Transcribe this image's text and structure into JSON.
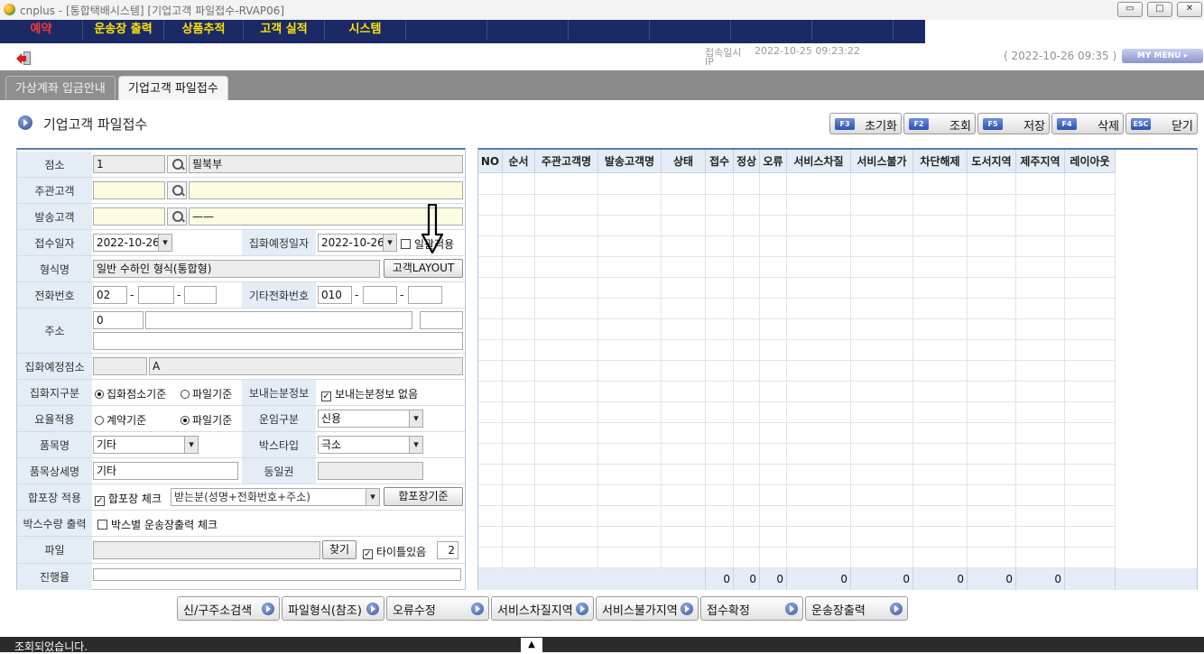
{
  "window": {
    "title": "cnplus - [통합택배시스템] [기업고객 파일접수-RVAP06]",
    "min_glyph": "▭",
    "max_glyph": "□",
    "close_glyph": "✕"
  },
  "menu": [
    "예약",
    "운송장 출력",
    "상품추적",
    "고객 실적",
    "시스템"
  ],
  "info": {
    "login_label": "접속일시",
    "login_value": "2022-10-25 09:23:22",
    "ip_label": "IP",
    "current_time": "( 2022-10-26 09:35 )",
    "my_menu": "MY MENU  ▸"
  },
  "tabs": [
    {
      "label": "가상계좌 입금안내",
      "active": false
    },
    {
      "label": "기업고객 파일접수",
      "active": true
    }
  ],
  "page": {
    "title": "기업고객 파일접수"
  },
  "function_buttons": [
    {
      "key": "F3",
      "label": "초기화"
    },
    {
      "key": "F2",
      "label": "조회"
    },
    {
      "key": "F5",
      "label": "저장"
    },
    {
      "key": "F4",
      "label": "삭제"
    },
    {
      "key": "ESC",
      "label": "닫기"
    }
  ],
  "form": {
    "branch": {
      "label": "점소",
      "code": "1",
      "name": "필북부"
    },
    "main_customer": {
      "label": "주관고객"
    },
    "sender": {
      "label": "발송고객",
      "name": "——"
    },
    "receipt_date": {
      "label": "접수일자",
      "value": "2022-10-26"
    },
    "pickup_date": {
      "label": "집화예정일자",
      "value": "2022-10-26",
      "bulk_label": "일괄적용"
    },
    "format": {
      "label": "형식명",
      "value": "일반   수하인 형식(통합형)",
      "layout_button": "고객LAYOUT"
    },
    "phone": {
      "label": "전화번호",
      "area": "02",
      "sep": "-"
    },
    "other_phone": {
      "label": "기타전화번호",
      "area": "010",
      "sep": "-"
    },
    "address": {
      "label": "주소",
      "zip": "0"
    },
    "pickup_branch": {
      "label": "집화예정점소",
      "name": "A"
    },
    "pickup_type": {
      "label": "집화지구분",
      "options": [
        "집화점소기준",
        "파일기준"
      ],
      "selected": 0
    },
    "sender_info": {
      "label": "보내는분정보",
      "checkbox_label": "보내는분정보 없음",
      "checked": true
    },
    "rate": {
      "label": "요율적용",
      "options": [
        "계약기준",
        "파일기준"
      ],
      "selected": 1
    },
    "freight_type": {
      "label": "운임구분",
      "value": "신용"
    },
    "item": {
      "label": "품목명",
      "value": "기타"
    },
    "box_type": {
      "label": "박스타입",
      "value": "극소"
    },
    "item_detail": {
      "label": "품목상세명",
      "value": "기타"
    },
    "same_zone": {
      "label": "동일권"
    },
    "combine": {
      "label": "합포장 적용",
      "checkbox_label": "합포장 체크",
      "checked": true,
      "criteria": "받는분(성명+전화번호+주소)",
      "button": "합포장기준"
    },
    "box_count": {
      "label": "박스수량 출력",
      "checkbox_label": "박스별 운송장출력 체크",
      "checked": false
    },
    "file": {
      "label": "파일",
      "browse": "찾기",
      "title_label": "타이틀있음",
      "title_checked": true,
      "title_rows": "2"
    },
    "progress": {
      "label": "진행율",
      "value": 0
    }
  },
  "grid": {
    "columns": [
      "NO",
      "순서",
      "주관고객명",
      "발송고객명",
      "상태",
      "접수",
      "정상",
      "오류",
      "서비스차질",
      "서비스불가",
      "차단해제",
      "도서지역",
      "제주지역",
      "레이아웃"
    ],
    "totals": [
      "",
      "",
      "",
      "",
      "",
      "0",
      "0",
      "0",
      "0",
      "0",
      "0",
      "0",
      "0",
      ""
    ]
  },
  "bottom_buttons": [
    "신/구주소검색",
    "파일형식(참조)",
    "오류수정",
    "서비스차질지역",
    "서비스불가지역",
    "접수확정",
    "운송장출력"
  ],
  "status": {
    "message": "조회되었습니다.",
    "arrow": "▲"
  }
}
